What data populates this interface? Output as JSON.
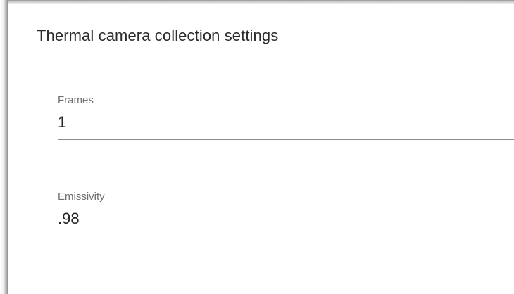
{
  "panel": {
    "title": "Thermal camera collection settings"
  },
  "fields": {
    "frames": {
      "label": "Frames",
      "value": "1"
    },
    "emissivity": {
      "label": "Emissivity",
      "value": ".98"
    }
  }
}
